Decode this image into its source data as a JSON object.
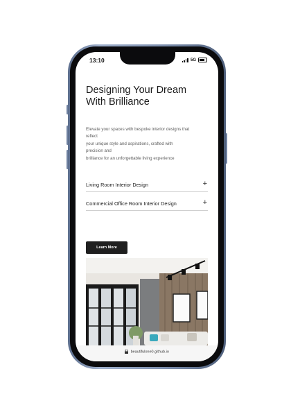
{
  "status_bar": {
    "time": "13:10",
    "network": "5G"
  },
  "hero": {
    "title_line1": "Designing Your Dream",
    "title_line2": "With Brilliance",
    "description_lines": [
      "Elevate your spaces with bespoke interior designs that",
      "reflect",
      "your unique style and aspirations, crafted with",
      "precision and",
      "brilliance for an unforgettable living experience"
    ]
  },
  "accordion": [
    {
      "label": "Living Room Interior Design",
      "icon": "+"
    },
    {
      "label": "Commercial Office Room Interior Design",
      "icon": "+"
    }
  ],
  "cta": {
    "label": "Learn More"
  },
  "browser": {
    "url": "beautifulone0.github.io"
  },
  "colors": {
    "button_bg": "#1f1f1f",
    "frame": "#7d8fae"
  }
}
